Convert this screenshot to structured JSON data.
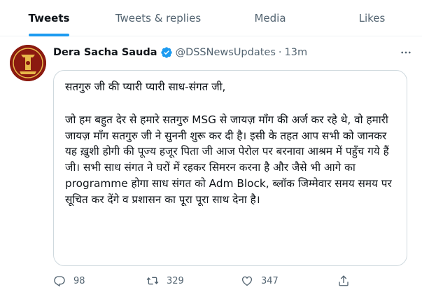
{
  "tabs": [
    {
      "label": "Tweets",
      "active": true
    },
    {
      "label": "Tweets & replies",
      "active": false
    },
    {
      "label": "Media",
      "active": false
    },
    {
      "label": "Likes",
      "active": false
    }
  ],
  "tweet": {
    "author_name": "Dera Sacha Sauda",
    "handle": "@DSSNewsUpdates",
    "separator": "·",
    "time": "13m",
    "verified": true,
    "paragraphs": [
      "सतगुरु जी की प्यारी प्यारी साध-संगत जी,",
      "जो हम बहुत देर से हमारे सतगुरु MSG से जायज़ माँग की अर्ज कर रहे थे, वो हमारी जायज़ माँग सतगुरु जी ने सुननी शुरू कर दी है। इसी के तहत आप सभी को जानकर यह ख़ुशी होगी की पूज्य हजूर पिता जी आज पेरोल पर बरनावा आश्रम में पहुँच गये हैं जी। सभी साध संगत ने घरों में रहकर सिमरन करना है और जैसे भी आगे का programme होगा साध संगत को Adm Block, ब्लॉक जिम्मेवार समय समय पर सूचित कर देंगे व प्रशासन का पूरा पूरा साथ देना है।"
    ],
    "replies": "98",
    "retweets": "329",
    "likes": "347"
  },
  "icons": {
    "more": "more-icon",
    "reply": "reply-icon",
    "retweet": "retweet-icon",
    "like": "heart-icon",
    "share": "share-icon",
    "verified": "verified-badge-icon"
  },
  "colors": {
    "accent": "#1d9bf0",
    "text": "#0f1419",
    "muted": "#536471",
    "border": "#cfd9de",
    "avatar_bg": "#8b1a10",
    "avatar_gold": "#e8b84a"
  }
}
